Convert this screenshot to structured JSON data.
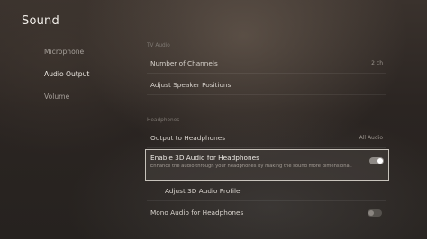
{
  "header": {
    "title": "Sound"
  },
  "sidebar": {
    "items": [
      {
        "label": "Microphone"
      },
      {
        "label": "Audio Output"
      },
      {
        "label": "Volume"
      }
    ]
  },
  "main": {
    "section_speakers": "TV Audio",
    "number_of_channels": {
      "label": "Number of Channels",
      "value": "2 ch"
    },
    "adjust_speaker_positions": {
      "label": "Adjust Speaker Positions"
    },
    "section_headphones": "Headphones",
    "output_to_headphones": {
      "label": "Output to Headphones",
      "value": "All Audio"
    },
    "enable_3d_audio": {
      "label": "Enable 3D Audio for Headphones",
      "description": "Enhance the audio through your headphones by making the sound more dimensional.",
      "state": "on"
    },
    "adjust_3d_audio_profile": {
      "label": "Adjust 3D Audio Profile"
    },
    "mono_audio": {
      "label": "Mono Audio for Headphones",
      "state": "off"
    }
  }
}
